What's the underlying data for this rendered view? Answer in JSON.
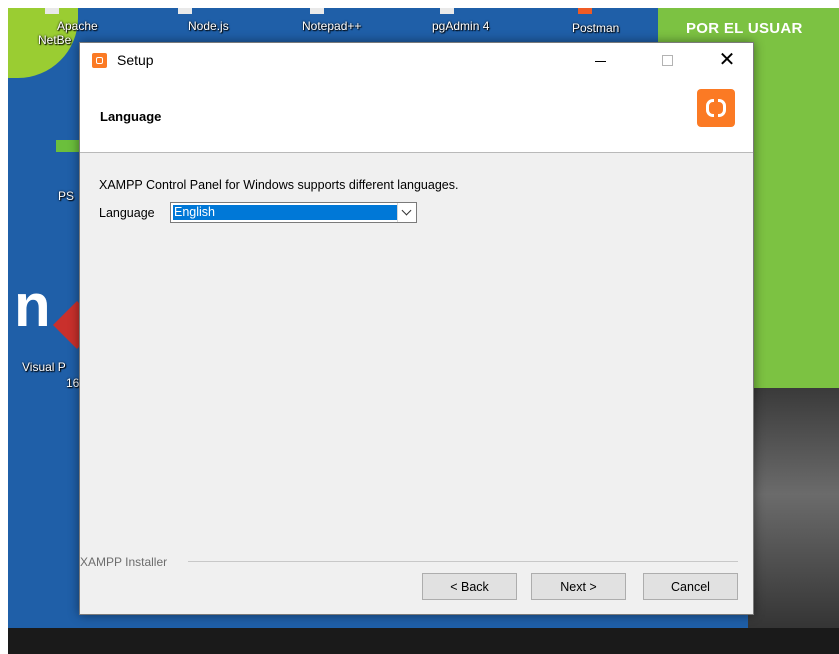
{
  "desktop": {
    "icons": [
      {
        "label": "Apache"
      },
      {
        "label": "NetBe"
      },
      {
        "label": "Node.js"
      },
      {
        "label": "Notepad++"
      },
      {
        "label": "pgAdmin 4"
      },
      {
        "label": "Postman"
      },
      {
        "label": "PS"
      },
      {
        "label": "Visual P"
      },
      {
        "label": "16"
      }
    ],
    "wallpaper_text": "POR EL USUAR",
    "wallpaper_letter": "n"
  },
  "window": {
    "title": "Setup",
    "controls": {
      "close_glyph": "✕"
    }
  },
  "header": {
    "title": "Language"
  },
  "content": {
    "description": "XAMPP Control Panel for Windows supports different languages.",
    "language_label": "Language",
    "language_selected": "English"
  },
  "footer": {
    "installer_label": "XAMPP Installer",
    "back_label": "< Back",
    "next_label": "Next >",
    "cancel_label": "Cancel"
  },
  "colors": {
    "accent": "#fb7a24",
    "selection": "#0078d7",
    "wallpaper_blue": "#1f5fa8",
    "wallpaper_green": "#7cc242"
  }
}
